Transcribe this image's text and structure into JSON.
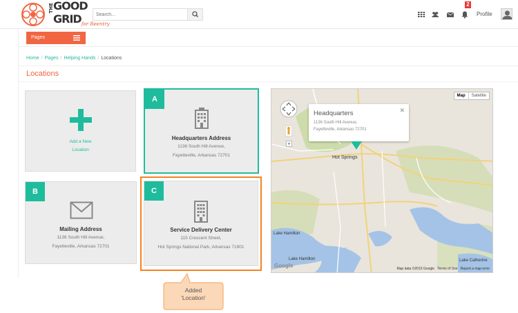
{
  "header": {
    "logo_the": "THE",
    "logo_good": "GOOD",
    "logo_grid": "GRID",
    "logo_tagline": "for Reentry",
    "search_placeholder": "Search...",
    "notification_count": "2",
    "profile_label": "Profile"
  },
  "pages_menu": {
    "label": "Pages"
  },
  "breadcrumb": {
    "items": [
      "Home",
      "Pages",
      "Helping Hands"
    ],
    "current": "Locations"
  },
  "page_title": "Locations",
  "add_card": {
    "line1": "Add a New",
    "line2": "Location"
  },
  "locations": [
    {
      "letter": "A",
      "name": "Headquarters Address",
      "addr1": "1136 South Hill Avenue,",
      "addr2": "Fayetteville, Arkansas 72701"
    },
    {
      "letter": "B",
      "name": "Mailing Address",
      "addr1": "1136 South Hill Avenue,",
      "addr2": "Fayetteville, Arkansas 72701"
    },
    {
      "letter": "C",
      "name": "Service Delivery Center",
      "addr1": "115 Crescent Street,",
      "addr2": "Hot Springs National Park, Arkansas 71901"
    }
  ],
  "map": {
    "popup_title": "Headquarters",
    "popup_line1": "1136 South Hill Avenue,",
    "popup_line2": "Fayetteville, Arkansas 72701",
    "type_map": "Map",
    "type_satellite": "Satellite",
    "city_label": "Hot Springs",
    "lake_label_1": "Lake Hamilton",
    "lake_label_2": "Lake Hamilton",
    "lake_label_3": "Lake Catherine",
    "footer_data": "Map data ©2015 Google",
    "footer_terms": "Terms of Use",
    "footer_report": "Report a map error",
    "google": "Google"
  },
  "callout": {
    "line1": "Added",
    "line2": "'Location'"
  },
  "colors": {
    "accent": "#f26543",
    "teal": "#1ebc9c",
    "highlight_orange": "#f58220"
  }
}
